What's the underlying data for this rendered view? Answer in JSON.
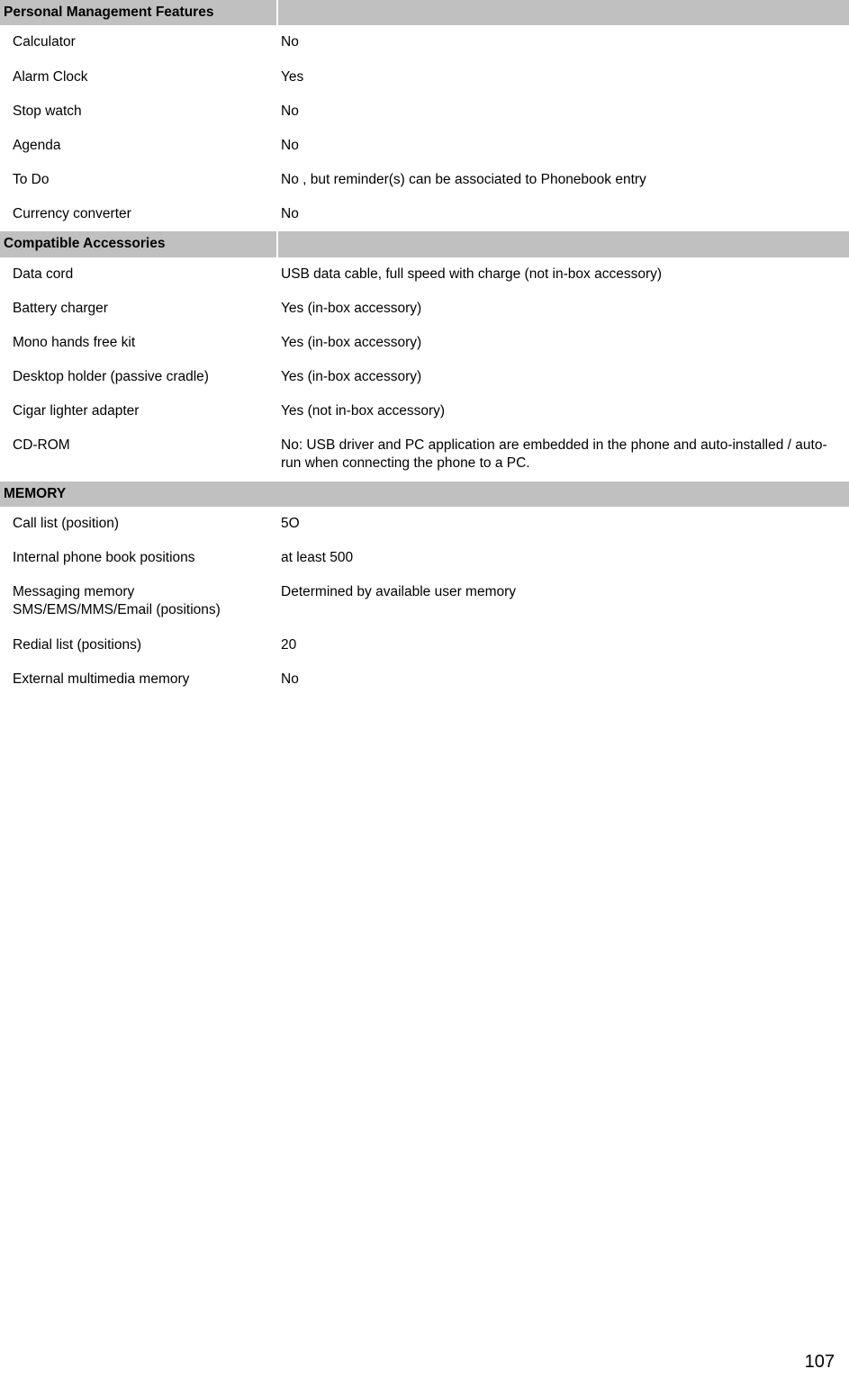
{
  "document": {
    "page_number": "107",
    "header_band_color": "#c0c0c0",
    "text_color": "#000000",
    "background_color": "#ffffff"
  },
  "sections": [
    {
      "title": "Personal Management Features",
      "has_divider": true,
      "rows": [
        {
          "label": "Calculator",
          "value": "No"
        },
        {
          "label": "Alarm Clock",
          "value": "Yes"
        },
        {
          "label": "Stop watch",
          "value": "No"
        },
        {
          "label": "Agenda",
          "value": "No"
        },
        {
          "label": "To Do",
          "value": "No , but reminder(s) can be associated to Phonebook entry"
        },
        {
          "label": "Currency converter",
          "value": "No"
        }
      ]
    },
    {
      "title": "Compatible Accessories",
      "has_divider": true,
      "rows": [
        {
          "label": "Data cord",
          "value": "USB data cable, full speed with charge (not in-box accessory)"
        },
        {
          "label": "Battery charger",
          "value": "Yes (in-box accessory)"
        },
        {
          "label": "Mono hands free kit",
          "value": "Yes (in-box accessory)"
        },
        {
          "label": "Desktop holder (passive cradle)",
          "value": "Yes (in-box accessory)"
        },
        {
          "label": "Cigar lighter adapter",
          "value": "Yes (not in-box accessory)"
        },
        {
          "label": "CD-ROM",
          "value": "No: USB driver and PC application are embedded in the phone and auto-installed / auto-run when connecting the phone to a PC."
        }
      ]
    },
    {
      "title": "MEMORY",
      "has_divider": false,
      "rows": [
        {
          "label": "Call list (position)",
          "value": "5O"
        },
        {
          "label": "Internal phone book positions",
          "value": "at least 500"
        },
        {
          "label": "Messaging memory SMS/EMS/MMS/Email (positions)",
          "value": "Determined by available user memory"
        },
        {
          "label": "Redial list (positions)",
          "value": "20"
        },
        {
          "label": "External multimedia memory",
          "value": "No"
        }
      ]
    }
  ]
}
